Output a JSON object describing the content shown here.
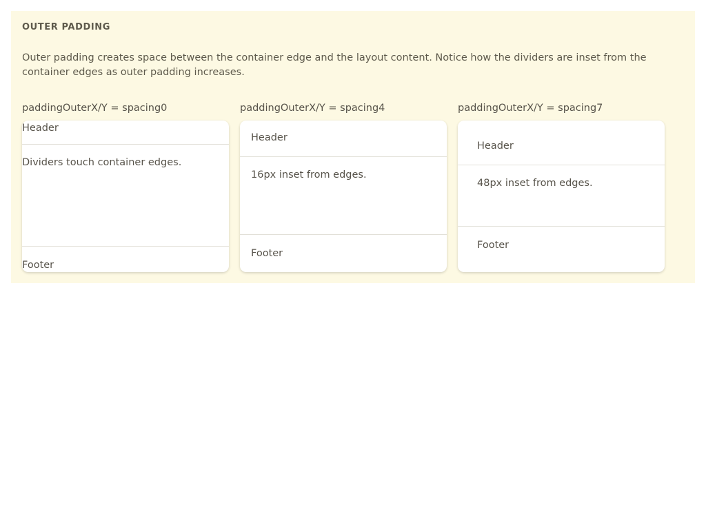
{
  "section": {
    "title": "OUTER PADDING",
    "description": "Outer padding creates space between the container edge and the layout content. Notice how the dividers are inset from the container edges as outer padding increases."
  },
  "examples": [
    {
      "label": "paddingOuterX/Y = spacing0",
      "header": "Header",
      "body": "Dividers touch container edges.",
      "footer": "Footer"
    },
    {
      "label": "paddingOuterX/Y = spacing4",
      "header": "Header",
      "body": "16px inset from edges.",
      "footer": "Footer"
    },
    {
      "label": "paddingOuterX/Y = spacing7",
      "header": "Header",
      "body": "48px inset from edges.",
      "footer": "Footer"
    }
  ],
  "colors": {
    "panel_background": "#fdf9e3",
    "card_background": "#ffffff",
    "text": "#57534a",
    "divider": "#e2e0d8"
  }
}
